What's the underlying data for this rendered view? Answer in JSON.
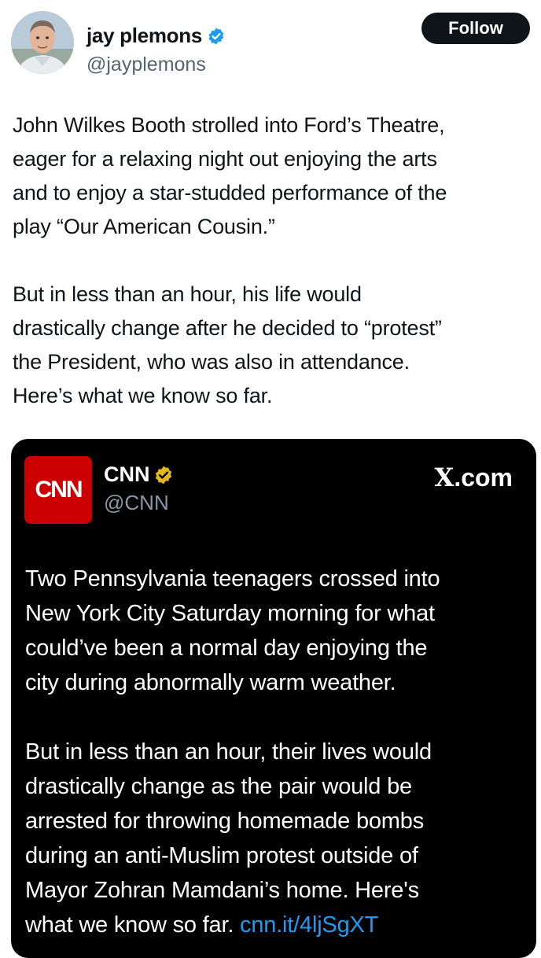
{
  "author": {
    "name": "jay plemons",
    "handle": "@jayplemons",
    "follow_label": "Follow",
    "verified_icon": "blue-verified-badge"
  },
  "post": {
    "paragraphs": [
      "John Wilkes Booth strolled into Ford’s Theatre,\neager for a relaxing night out enjoying the arts\nand to enjoy a star-studded performance of the\nplay “Our American Cousin.”",
      "But in less than an hour, his life would\ndrastically change after he decided to “protest”\nthe President, who was also in attendance.\nHere’s what we know so far."
    ]
  },
  "embed": {
    "logo_text": "CNN",
    "name": "CNN",
    "handle": "@CNN",
    "source": ".com",
    "source_glyph": "X",
    "verified_icon": "gold-verified-badge",
    "paragraphs": [
      "Two Pennsylvania teenagers crossed into\nNew York City Saturday morning for what\ncould’ve been a normal day enjoying the\ncity during abnormally warm weather.",
      "But in less than an hour, their lives would\ndrastically change as the pair would be\narrested for throwing homemade bombs\nduring an anti-Muslim protest outside of\nMayor Zohran Mamdani’s home. Here's\nwhat we know so far. "
    ],
    "link": "cnn.it/4ljSgXT"
  },
  "colors": {
    "background": "#ffffff",
    "text": "#0f1419",
    "muted": "#536471",
    "embed_background": "#000000",
    "link": "#1d9bf0",
    "cnn_red": "#cc0000",
    "gold": "#e2b719",
    "blue_badge": "#1d9bf0"
  }
}
